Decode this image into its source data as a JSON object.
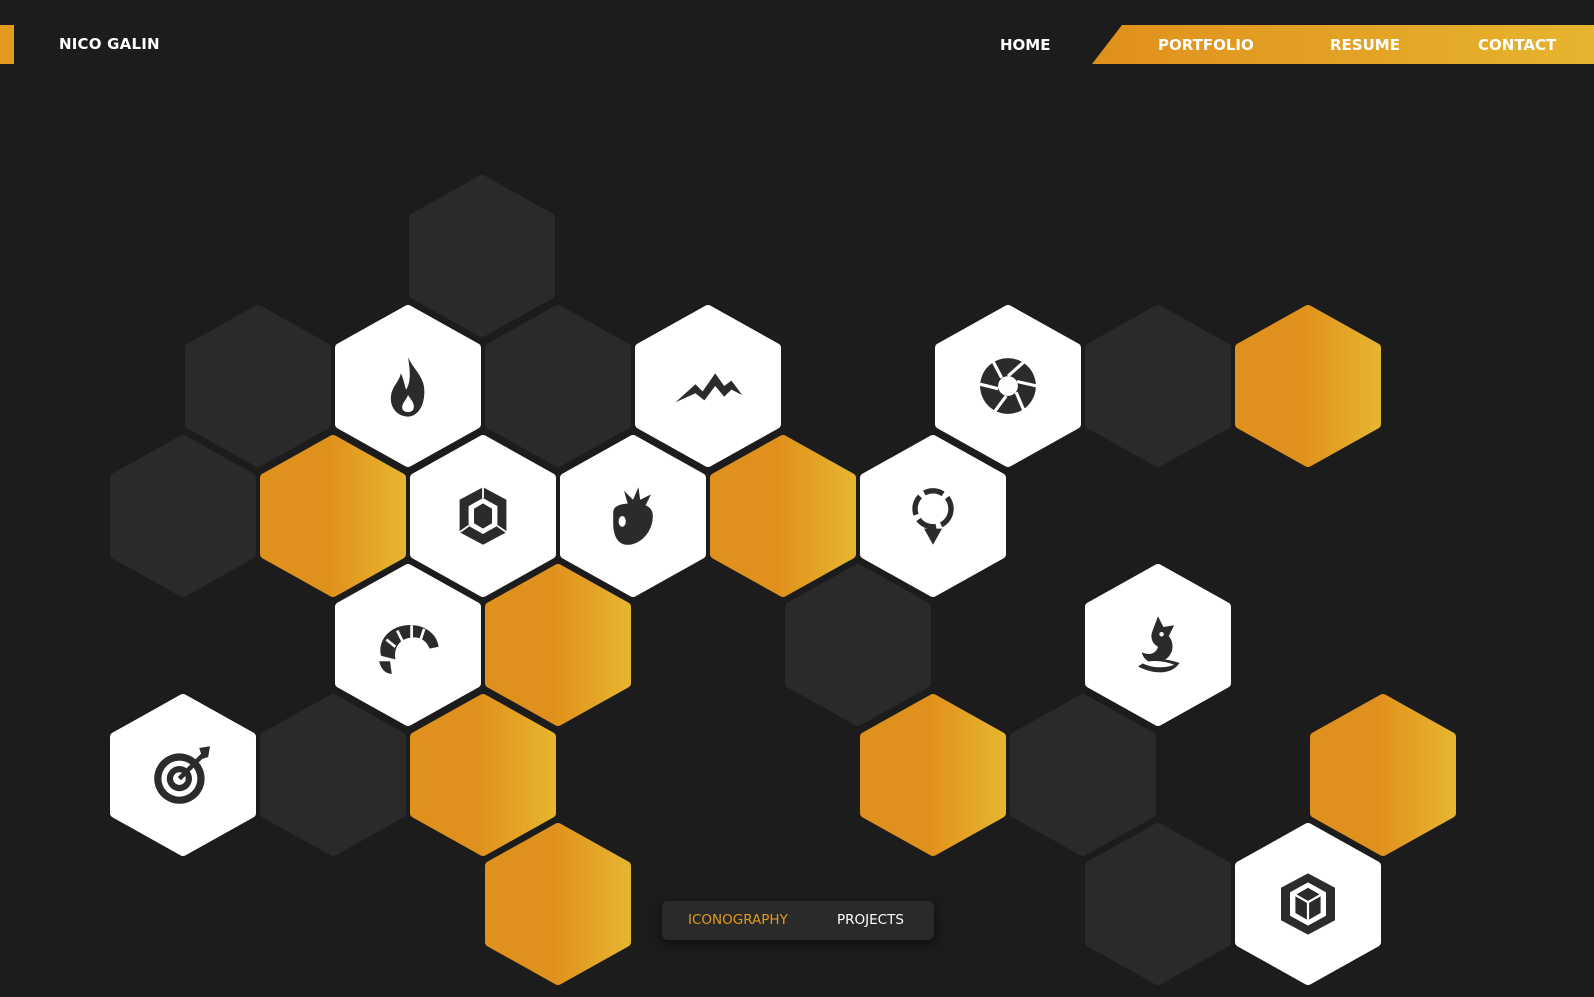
{
  "header": {
    "brand": "NICO GALIN",
    "nav": {
      "home": "HOME",
      "portfolio": "PORTFOLIO",
      "resume": "RESUME",
      "contact": "CONTACT"
    }
  },
  "colors": {
    "background": "#1c1c1c",
    "hex_dark": "#2a2a2a",
    "hex_white": "#ffffff",
    "accent_start": "#e0901c",
    "accent_end": "#e6b42e",
    "icon": "#2b2b2b"
  },
  "hex_grid": {
    "tiles": [
      {
        "kind": "dark"
      },
      {
        "kind": "dark"
      },
      {
        "kind": "icon",
        "icon": "fire-icon"
      },
      {
        "kind": "dark"
      },
      {
        "kind": "icon",
        "icon": "mountain-icon"
      },
      {
        "kind": "icon",
        "icon": "camera-aperture-icon"
      },
      {
        "kind": "dark"
      },
      {
        "kind": "accent"
      },
      {
        "kind": "dark"
      },
      {
        "kind": "accent"
      },
      {
        "kind": "icon",
        "icon": "gem-icon"
      },
      {
        "kind": "icon",
        "icon": "strawberry-icon"
      },
      {
        "kind": "accent"
      },
      {
        "kind": "icon",
        "icon": "location-pin-icon"
      },
      {
        "kind": "icon",
        "icon": "croissant-icon"
      },
      {
        "kind": "accent"
      },
      {
        "kind": "dark"
      },
      {
        "kind": "icon",
        "icon": "fox-icon"
      },
      {
        "kind": "icon",
        "icon": "target-icon"
      },
      {
        "kind": "dark"
      },
      {
        "kind": "accent"
      },
      {
        "kind": "accent"
      },
      {
        "kind": "dark"
      },
      {
        "kind": "accent"
      },
      {
        "kind": "accent"
      },
      {
        "kind": "dark"
      },
      {
        "kind": "icon",
        "icon": "cube-icon"
      }
    ]
  },
  "filter_toggle": {
    "active": "ICONOGRAPHY",
    "inactive": "PROJECTS"
  }
}
